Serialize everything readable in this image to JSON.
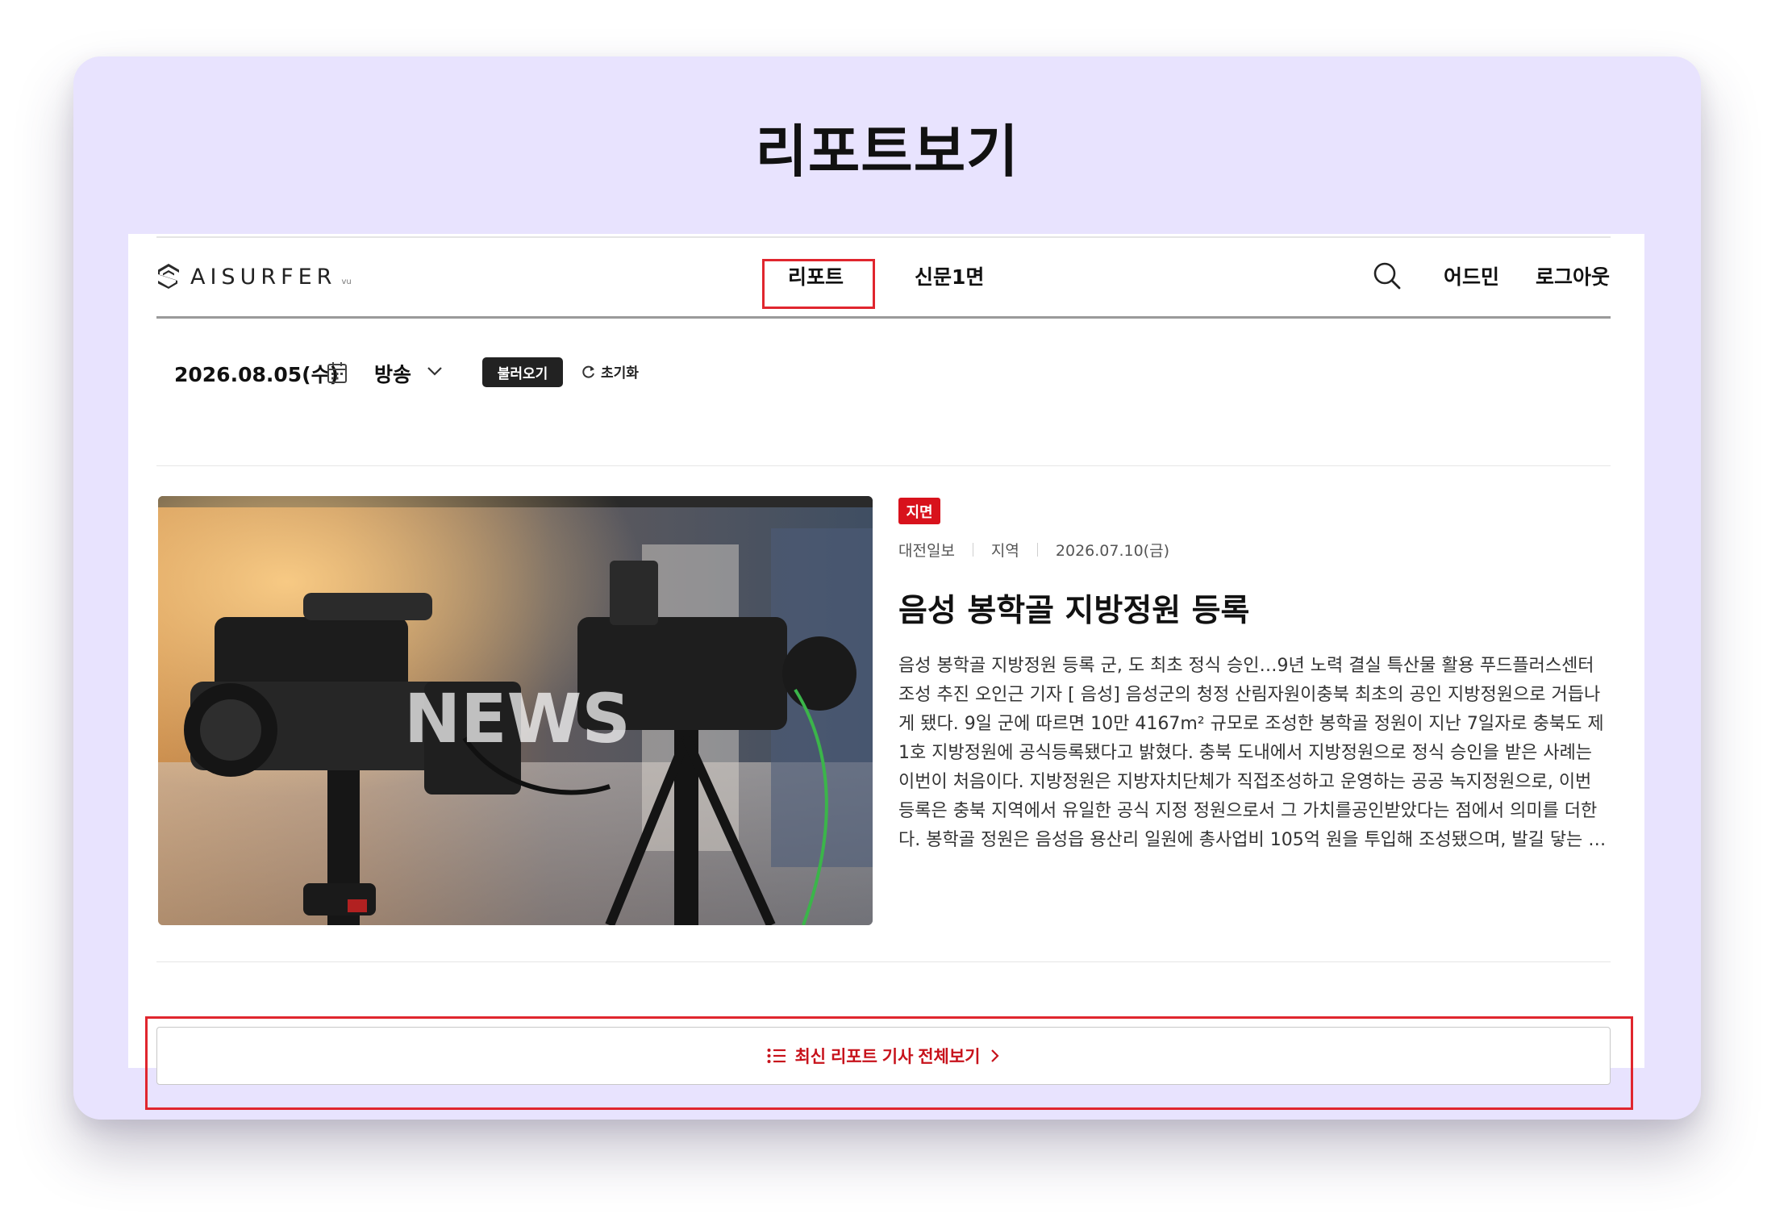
{
  "page_heading": "리포트보기",
  "header": {
    "logo_text": "AISURFER",
    "logo_sub": "vu",
    "nav": [
      {
        "label": "리포트",
        "active": true
      },
      {
        "label": "신문1면",
        "active": false
      }
    ],
    "search_icon": "search-icon",
    "admin_label": "어드민",
    "logout_label": "로그아웃"
  },
  "filters": {
    "date": "2026.08.05(수)",
    "type": "방송",
    "load_label": "불러오기",
    "reset_label": "초기화"
  },
  "article": {
    "thumbnail_text": "NEWS",
    "badge": "지면",
    "source": "대전일보",
    "category": "지역",
    "date": "2026.07.10(금)",
    "headline": "음성 봉학골 지방정원 등록",
    "summary": "음성 봉학골 지방정원 등록 군, 도 최초 정식 승인…9년 노력 결실 특산물 활용 푸드플러스센터 조성 추진 오인근 기자 [ 음성] 음성군의 청정 산림자원이충북 최초의 공인 지방정원으로 거듭나게 됐다. 9일 군에 따르면 10만 4167m² 규모로 조성한 봉학골 정원이 지난 7일자로 충북도 제1호 지방정원에 공식등록됐다고 밝혔다. 충북 도내에서 지방정원으로 정식 승인을 받은 사례는 이번이 처음이다. 지방정원은 지방자치단체가 직접조성하고 운영하는 공공 녹지정원으로, 이번 등록은 충북 지역에서 유일한 공식 지정 정원으로서 그 가치를공인받았다는 점에서 의미를 더한다. 봉학골 정원은 음성읍 용산리 일원에 총사업비 105억 원을 투입해 조성됐으며, 발길 닿는 …"
  },
  "view_all": {
    "label": "최신 리포트 기사 전체보기"
  },
  "colors": {
    "card_bg": "#e8e3fe",
    "highlight": "#e0262e",
    "accent_red": "#c7121b",
    "badge_red": "#d8121c"
  }
}
